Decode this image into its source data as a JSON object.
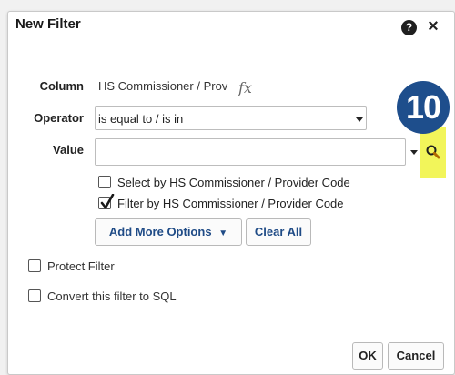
{
  "dialog": {
    "title": "New Filter",
    "help_icon": "?",
    "close_icon": "×"
  },
  "column": {
    "label": "Column",
    "value": "HS Commissioner / Prov",
    "fx_icon": "fx"
  },
  "operator": {
    "label": "Operator",
    "selected": "is equal to / is in"
  },
  "value": {
    "label": "Value",
    "input_value": ""
  },
  "step_badge": "10",
  "options": {
    "select_by": {
      "label": "Select by HS Commissioner / Provider Code",
      "checked": false
    },
    "filter_by": {
      "label": "Filter by HS Commissioner / Provider Code",
      "checked": true
    }
  },
  "buttons": {
    "add_more_options": "Add More Options",
    "clear_all": "Clear All",
    "ok": "OK",
    "cancel": "Cancel"
  },
  "protect_filter": {
    "label": "Protect Filter",
    "checked": false
  },
  "convert_sql": {
    "label": "Convert this filter to SQL",
    "checked": false
  },
  "colors": {
    "highlight": "#f2f55a",
    "badge": "#1e4e8c",
    "link_blue": "#1f4b86"
  }
}
